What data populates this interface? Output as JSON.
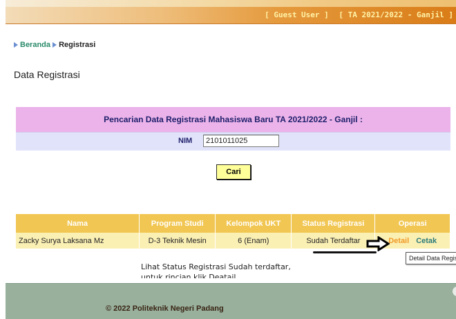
{
  "header": {
    "user_link": "[ Guest User ]",
    "period_link": "[ TA 2021/2022 - Ganjil ]"
  },
  "breadcrumb": {
    "home": "Beranda",
    "current": "Registrasi"
  },
  "page_title": "Data Registrasi",
  "search": {
    "heading": "Pencarian Data Registrasi Mahasiswa Baru TA 2021/2022 - Ganjil :",
    "nim_label": "NIM",
    "nim_value": "2101011025",
    "button_label": "Cari"
  },
  "results": {
    "columns": [
      "Nama",
      "Program Studi",
      "Kelompok UKT",
      "Status Registrasi",
      "Operasi"
    ],
    "row": {
      "nama": "Zacky Surya Laksana Mz",
      "program_studi": "D-3 Teknik Mesin",
      "kelompok_ukt": "6 (Enam)",
      "status": "Sudah Terdaftar",
      "detail_link": "Detail",
      "cetak_link": "Cetak"
    }
  },
  "tooltip": "Detail Data Registrasi",
  "note": {
    "line1": "Lihat Status Registrasi Sudah terdaftar,",
    "line2": "untuk rincian klik Deatail"
  },
  "footer": {
    "copyright": "© 2022 Politeknik Negeri Padang"
  },
  "colors": {
    "header_orange": "#e59a3d",
    "search_header": "#ebb3ea",
    "search_row": "#e1e3fb",
    "table_header": "#f1c652",
    "table_row": "#fbf0b4",
    "footer": "#98b09c",
    "detail_link": "#f09a28",
    "cetak_link": "#2a7a7a"
  }
}
